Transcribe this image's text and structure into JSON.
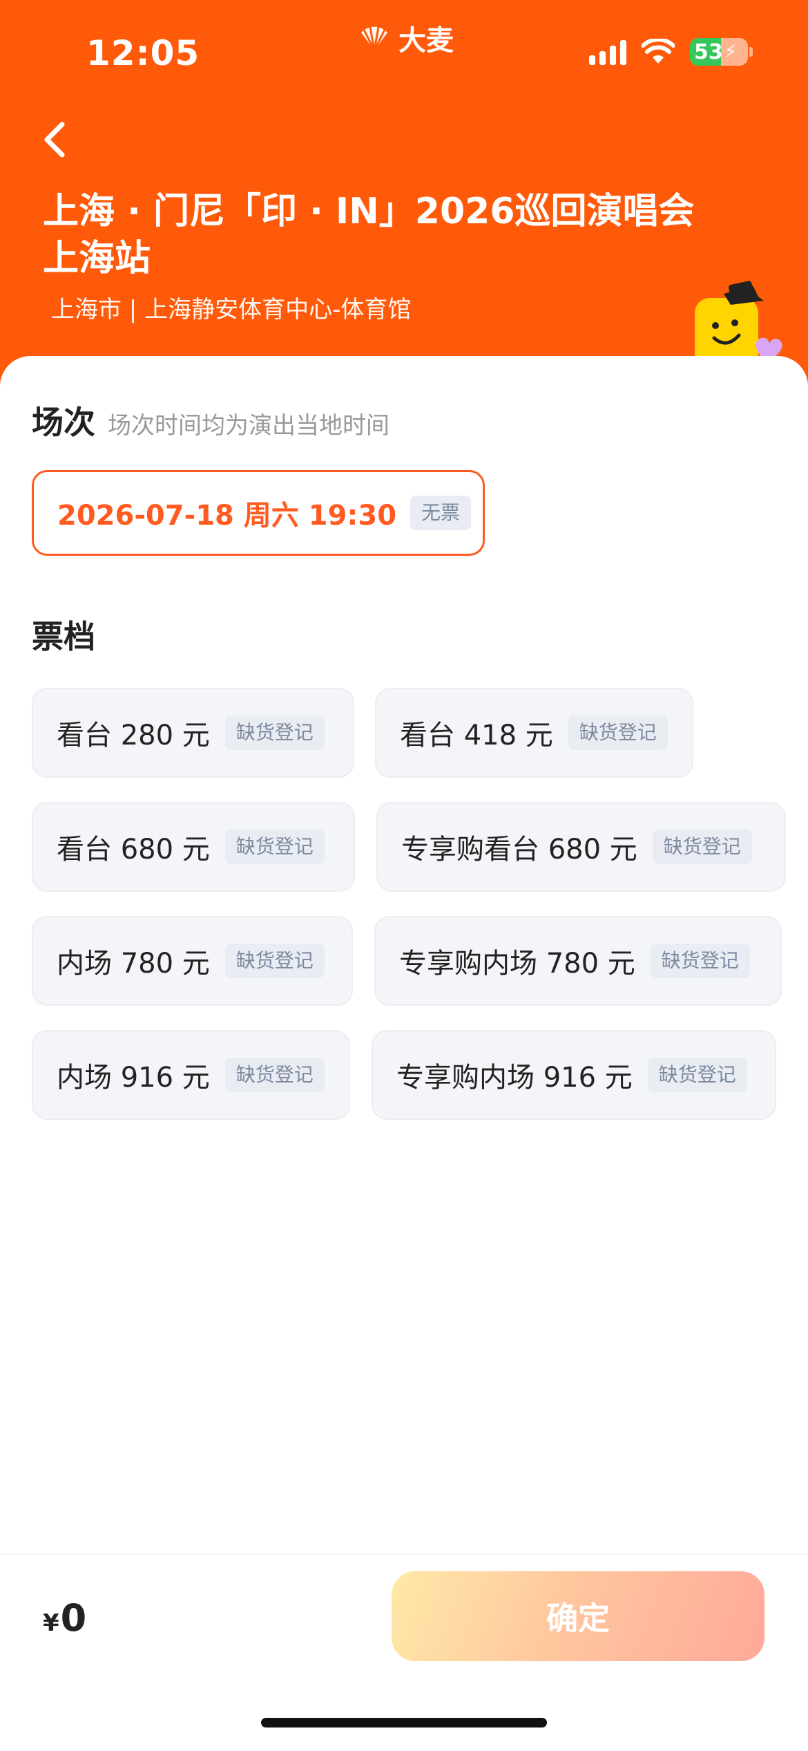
{
  "status_bar": {
    "time": "12:05",
    "battery": "53"
  },
  "brand": {
    "name": "大麦"
  },
  "header": {
    "title": "上海 · 门尼「印 · IN」2026巡回演唱会上海站",
    "venue": "上海市 | 上海静安体育中心-体育馆"
  },
  "session_section": {
    "title": "场次",
    "subtitle": "场次时间均为演出当地时间",
    "selected": {
      "label": "2026-07-18 周六 19:30",
      "tag": "无票"
    }
  },
  "tier_section": {
    "title": "票档",
    "tiers": [
      {
        "label": "看台 280 元",
        "tag": "缺货登记"
      },
      {
        "label": "看台 418 元",
        "tag": "缺货登记"
      },
      {
        "label": "看台 680 元",
        "tag": "缺货登记"
      },
      {
        "label": "专享购看台 680 元",
        "tag": "缺货登记"
      },
      {
        "label": "内场 780 元",
        "tag": "缺货登记"
      },
      {
        "label": "专享购内场 780 元",
        "tag": "缺货登记"
      },
      {
        "label": "内场 916 元",
        "tag": "缺货登记"
      },
      {
        "label": "专享购内场 916 元",
        "tag": "缺货登记"
      }
    ]
  },
  "footer": {
    "currency": "¥",
    "total": "0",
    "confirm_label": "确定"
  },
  "colors": {
    "brand_orange": "#ff5a0a",
    "accent_text": "#ff5a1f",
    "tag_bg": "#e9ecf2"
  },
  "icons": [
    "back-arrow-icon",
    "damai-logo-icon",
    "signal-icon",
    "wifi-icon",
    "battery-icon",
    "mascot-icon"
  ]
}
